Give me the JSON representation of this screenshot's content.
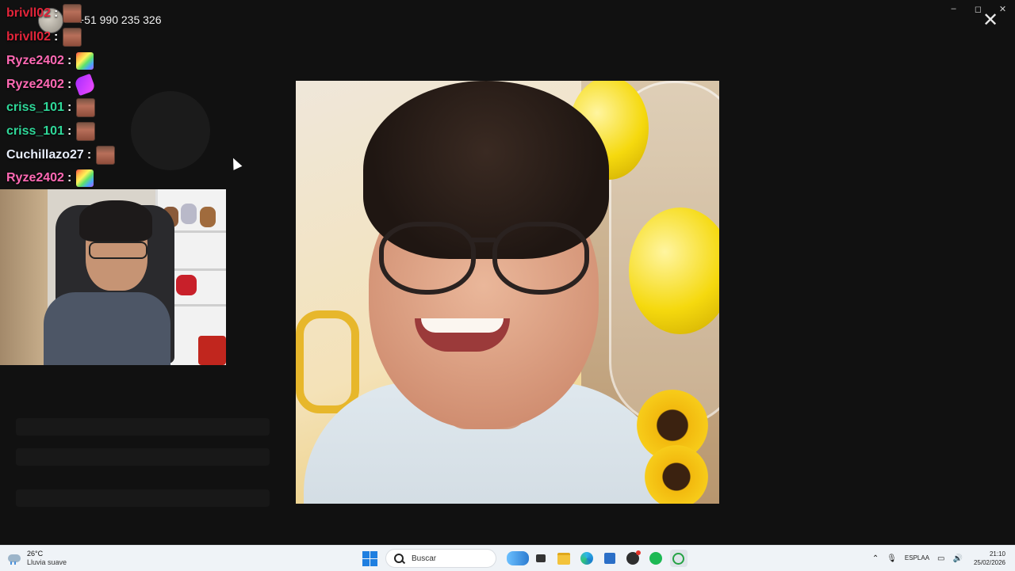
{
  "overlay": {
    "phone_number": "+51 990 235 326"
  },
  "chat": {
    "messages": [
      {
        "user": "brivll02",
        "color": "#e3253a",
        "separator": ":",
        "emote": "emote-face-icon"
      },
      {
        "user": "brivll02",
        "color": "#e3253a",
        "separator": ":",
        "emote": "emote-face-icon"
      },
      {
        "user": "Ryze2402",
        "color": "#ff69b4",
        "separator": ":",
        "emote": "emote-rainbow-icon"
      },
      {
        "user": "Ryze2402",
        "color": "#ff69b4",
        "separator": ":",
        "emote": "emote-purple-icon"
      },
      {
        "user": "criss_101",
        "color": "#2fd899",
        "separator": ":",
        "emote": "emote-face-icon"
      },
      {
        "user": "criss_101",
        "color": "#2fd899",
        "separator": ":",
        "emote": "emote-face-icon"
      },
      {
        "user": "Cuchillazo27",
        "color": "#e8eefb",
        "separator": ":",
        "emote": "emote-face-icon"
      },
      {
        "user": "Ryze2402",
        "color": "#ff69b4",
        "separator": ":",
        "emote": "emote-rainbow-icon"
      }
    ]
  },
  "window": {
    "minimize": "–",
    "maximize": "◻",
    "close": "✕",
    "viewer_close": "✕"
  },
  "taskbar": {
    "weather_temp": "26°C",
    "weather_desc": "Lluvia suave",
    "search_placeholder": "Buscar",
    "lang_line1": "ESP",
    "lang_line2": "LAA",
    "time": "21:10",
    "date": "25/02/2026"
  }
}
